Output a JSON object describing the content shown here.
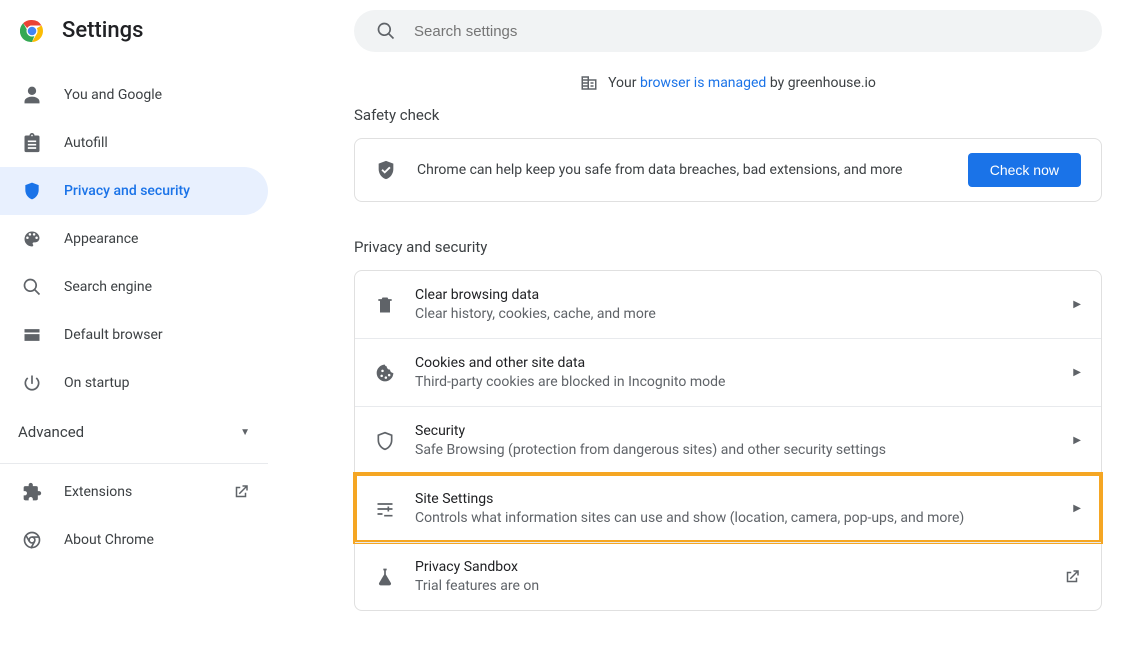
{
  "header": {
    "title": "Settings",
    "search_placeholder": "Search settings"
  },
  "managed": {
    "prefix": "Your ",
    "link": "browser is managed",
    "suffix": " by greenhouse.io"
  },
  "sidebar": {
    "items": [
      {
        "label": "You and Google"
      },
      {
        "label": "Autofill"
      },
      {
        "label": "Privacy and security"
      },
      {
        "label": "Appearance"
      },
      {
        "label": "Search engine"
      },
      {
        "label": "Default browser"
      },
      {
        "label": "On startup"
      }
    ],
    "advanced_label": "Advanced",
    "extensions_label": "Extensions",
    "about_label": "About Chrome"
  },
  "safety_check": {
    "header": "Safety check",
    "text": "Chrome can help keep you safe from data breaches, bad extensions, and more",
    "button": "Check now"
  },
  "privacy_section": {
    "header": "Privacy and security",
    "rows": [
      {
        "title": "Clear browsing data",
        "sub": "Clear history, cookies, cache, and more",
        "trailing": "chevron"
      },
      {
        "title": "Cookies and other site data",
        "sub": "Third-party cookies are blocked in Incognito mode",
        "trailing": "chevron"
      },
      {
        "title": "Security",
        "sub": "Safe Browsing (protection from dangerous sites) and other security settings",
        "trailing": "chevron"
      },
      {
        "title": "Site Settings",
        "sub": "Controls what information sites can use and show (location, camera, pop-ups, and more)",
        "trailing": "chevron"
      },
      {
        "title": "Privacy Sandbox",
        "sub": "Trial features are on",
        "trailing": "launch"
      }
    ]
  }
}
